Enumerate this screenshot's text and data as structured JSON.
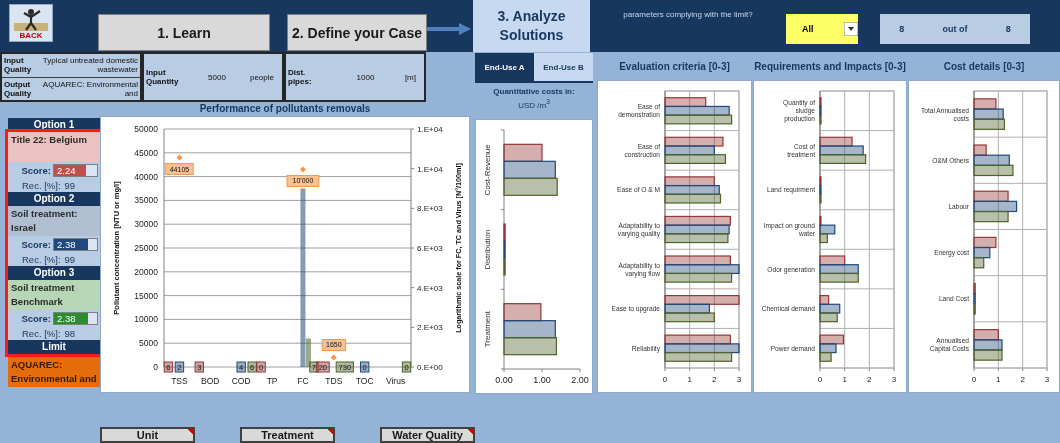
{
  "header": {
    "back_label": "BACK",
    "steps": [
      {
        "label": "1. Learn",
        "selected": false
      },
      {
        "label": "2. Define your Case",
        "selected": false
      },
      {
        "label": "3. Analyze Solutions",
        "selected": true
      }
    ],
    "compliance": {
      "question": "parameters complying with the limit?",
      "filter": "All",
      "count": "8",
      "separator": "out of",
      "total": "8"
    }
  },
  "input_boxes": [
    {
      "rows": [
        {
          "label": "Input Quality",
          "value": "Typical untreated domestic wastewater"
        },
        {
          "label": "Output Quality",
          "value": "AQUAREC: Environmental and"
        }
      ]
    },
    {
      "rows": [
        {
          "label": "Input Quantity",
          "value": "5000",
          "unit": "people"
        }
      ]
    },
    {
      "rows": [
        {
          "label": "Dist. pipes:",
          "value": "1000",
          "unit": "[m]"
        }
      ]
    }
  ],
  "options": [
    {
      "header": "Option 1",
      "name": "Title 22: Belgium",
      "color": "#c0504d",
      "score_label": "Score:",
      "score": "2.24",
      "level": 0.75,
      "rec_label": "Rec. [%]:",
      "rec": "99"
    },
    {
      "header": "Option 2",
      "name": "Soil treatment: Israel",
      "color": "#1f497d",
      "score_label": "Score:",
      "score": "2.38",
      "level": 0.79,
      "rec_label": "Rec. [%]:",
      "rec": "99"
    },
    {
      "header": "Option 3",
      "name": "Soil treatment Benchmark",
      "color": "#2e8b2e",
      "score_label": "Score:",
      "score": "2.38",
      "level": 0.79,
      "rec_label": "Rec. [%]:",
      "rec": "98"
    }
  ],
  "limit": {
    "header": "Limit",
    "name": "AQUAREC: Environmental and"
  },
  "end_use_tabs": [
    {
      "label": "End-Use A",
      "selected": true
    },
    {
      "label": "End-Use B",
      "selected": false
    }
  ],
  "cost_unit": {
    "label": "Quantitative costs in:",
    "unit": "USD /m$^{3}$"
  },
  "pollutant_chart": {
    "right_axis": {
      "label": "Logarithmic scale for FC, TC and Virus [N°/100ml]",
      "ticks": [
        "1.E+04",
        "1.E+04",
        "8.E+03",
        "6.E+03",
        "4.E+03",
        "2.E+03",
        "0.E+00"
      ]
    },
    "chart_data": {
      "type": "bar",
      "title": "Performance of pollutants removals",
      "ylabel": "Pollutant concentration [NTU or mg/l]",
      "categories": [
        "TSS",
        "BOD",
        "COD",
        "TP",
        "FC",
        "TDS",
        "TOC",
        "Virus"
      ],
      "series": [
        {
          "type": "bar",
          "color": "#953735",
          "values": [
            0,
            0,
            0,
            0,
            0,
            0,
            0,
            0
          ]
        },
        {
          "type": "bar",
          "color": "#1f497d",
          "values": [
            0,
            0,
            0,
            0,
            37500,
            0,
            0,
            0
          ]
        },
        {
          "type": "bar",
          "color": "#4f6228",
          "values": [
            0,
            0,
            0,
            0,
            6000,
            0,
            0,
            0
          ]
        },
        {
          "type": "scatter",
          "color": "#f79646",
          "values": [
            44000,
            null,
            null,
            null,
            41500,
            2000,
            null,
            null
          ]
        }
      ],
      "grid": true,
      "ylim": [
        0,
        50000
      ],
      "yticks": [
        0,
        5000,
        10000,
        15000,
        20000,
        25000,
        30000,
        35000,
        40000,
        45000,
        50000
      ],
      "value_labels": [
        [
          "6",
          "3",
          null,
          "0",
          null,
          "20",
          null,
          null
        ],
        [
          "2",
          null,
          "4",
          null,
          null,
          null,
          "0",
          null
        ],
        [
          null,
          null,
          "6",
          null,
          "7",
          "730",
          null,
          "0"
        ],
        [
          "44105",
          null,
          null,
          null,
          "10'000",
          "1650",
          null,
          null
        ]
      ]
    }
  },
  "cost_chart": {
    "chart_data": {
      "type": "bar",
      "orientation": "horizontal",
      "categories": [
        "Cost-Revenue",
        "Distribution",
        "Treatment"
      ],
      "series": [
        {
          "color": "#953735",
          "values": [
            1.0,
            0.03,
            0.97
          ]
        },
        {
          "color": "#1f497d",
          "values": [
            1.35,
            0.03,
            1.35
          ]
        },
        {
          "color": "#4f6228",
          "values": [
            1.4,
            0.03,
            1.38
          ]
        }
      ],
      "xlim": [
        0,
        2
      ],
      "xticks": [
        {
          "value": 0,
          "label": "0.00"
        },
        {
          "value": 1,
          "label": "1.00"
        },
        {
          "value": 2,
          "label": "2.00"
        }
      ]
    }
  },
  "criteria_charts": [
    {
      "chart_data": {
        "type": "bar",
        "orientation": "horizontal",
        "title": "Evaluation criteria [0-3]",
        "categories": [
          "Ease of demonstration",
          "Ease of construction",
          "Ease of O & M",
          "Adaptability to varying quality",
          "Adaptability to varying flow",
          "Ease to upgrade",
          "Reliability"
        ],
        "series": [
          {
            "color": "#953735",
            "values": [
              1.65,
              2.35,
              2.0,
              2.65,
              2.65,
              3.0,
              2.65
            ]
          },
          {
            "color": "#1f497d",
            "values": [
              2.6,
              2.0,
              2.2,
              2.6,
              3.0,
              1.8,
              3.0
            ]
          },
          {
            "color": "#4f6228",
            "values": [
              2.7,
              2.45,
              2.25,
              2.55,
              2.7,
              2.0,
              2.7
            ]
          }
        ],
        "xlim": [
          0,
          3
        ],
        "xticks": [
          0,
          1,
          2,
          3
        ]
      }
    },
    {
      "chart_data": {
        "type": "bar",
        "orientation": "horizontal",
        "title": "Requirements and Impacts [0-3]",
        "categories": [
          "Quantity of sludge production",
          "Cost of treatment",
          "Land requirment",
          "Impact on ground water",
          "Odor generation",
          "Chemical demand",
          "Power demand"
        ],
        "series": [
          {
            "color": "#953735",
            "values": [
              0.03,
              1.3,
              0.03,
              0,
              1.0,
              0.35,
              0.95
            ]
          },
          {
            "color": "#1f497d",
            "values": [
              0.03,
              1.75,
              0.03,
              0.6,
              1.55,
              0.8,
              0.65
            ]
          },
          {
            "color": "#4f6228",
            "values": [
              0.03,
              1.85,
              0.03,
              0.3,
              1.55,
              0.7,
              0.45
            ]
          }
        ],
        "xlim": [
          0,
          3
        ],
        "xticks": [
          0,
          1,
          2,
          3
        ]
      }
    },
    {
      "chart_data": {
        "type": "bar",
        "orientation": "horizontal",
        "title": "Cost details [0-3]",
        "categories": [
          "Total Annualised costs",
          "O&M Others",
          "Labour",
          "Energy cost",
          "Land Cost",
          "Annualised Capital Costs"
        ],
        "series": [
          {
            "color": "#953735",
            "values": [
              0.9,
              0.5,
              1.4,
              0.9,
              0.05,
              1.0
            ]
          },
          {
            "color": "#1f497d",
            "values": [
              1.2,
              1.45,
              1.75,
              0.65,
              0.05,
              1.15
            ]
          },
          {
            "color": "#4f6228",
            "values": [
              1.25,
              1.6,
              1.4,
              0.4,
              0.05,
              1.15
            ]
          }
        ],
        "xlim": [
          0,
          3
        ],
        "xticks": [
          0,
          1,
          2,
          3
        ]
      }
    }
  ],
  "bottom_buttons": [
    "Unit",
    "Treatment",
    "Water Quality"
  ]
}
